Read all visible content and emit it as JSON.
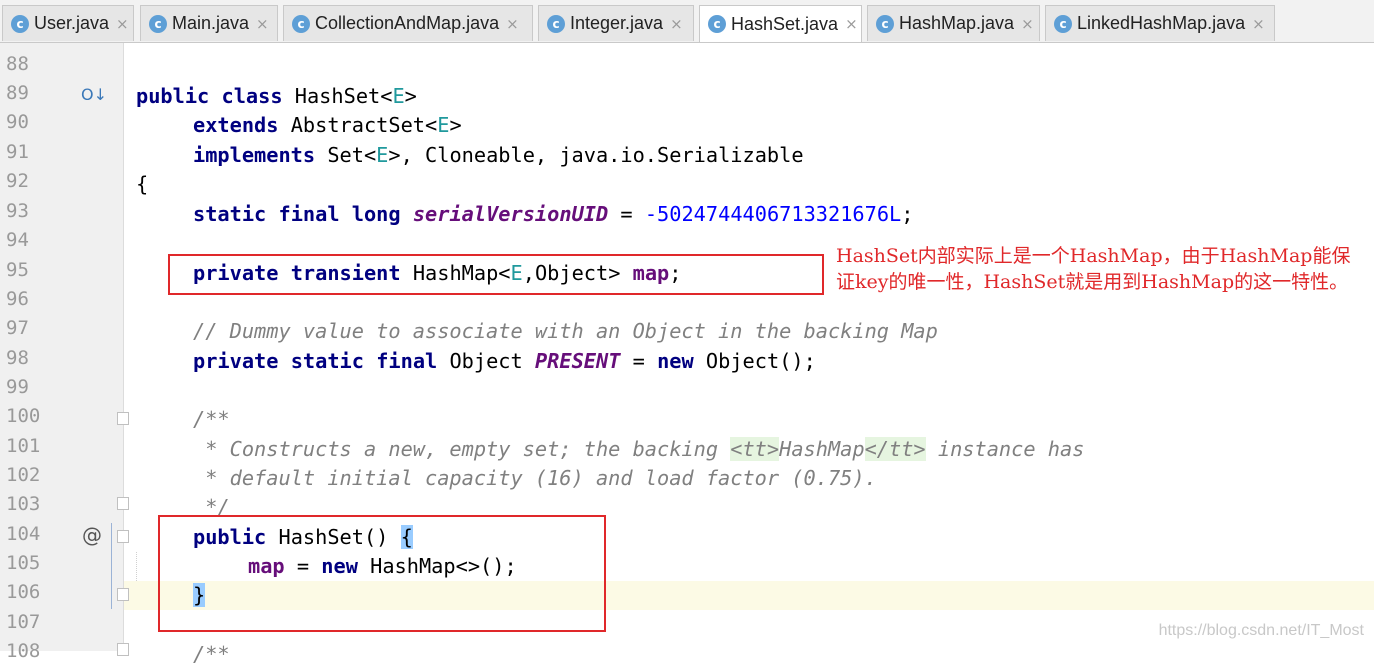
{
  "tabs": [
    {
      "label": "User.java",
      "active": false
    },
    {
      "label": "Main.java",
      "active": false
    },
    {
      "label": "CollectionAndMap.java",
      "active": false
    },
    {
      "label": "Integer.java",
      "active": false
    },
    {
      "label": "HashSet.java",
      "active": true
    },
    {
      "label": "HashMap.java",
      "active": false
    },
    {
      "label": "LinkedHashMap.java",
      "active": false
    }
  ],
  "tab_close_glyph": "×",
  "line_numbers": [
    "88",
    "89",
    "90",
    "91",
    "92",
    "93",
    "94",
    "95",
    "96",
    "97",
    "98",
    "99",
    "100",
    "101",
    "102",
    "103",
    "104",
    "105",
    "106",
    "107",
    "108"
  ],
  "code": {
    "l89": {
      "k1": "public",
      "k2": "class",
      "name": "HashSet<",
      "tp": "E",
      "end": ">"
    },
    "l90": {
      "k": "extends",
      "name": "AbstractSet<",
      "tp": "E",
      "end": ">"
    },
    "l91": {
      "k": "implements",
      "a": "Set<",
      "tp": "E",
      "rest": ">, Cloneable, java.io.Serializable"
    },
    "l92": {
      "text": "{"
    },
    "l93": {
      "k1": "static",
      "k2": "final",
      "k3": "long",
      "field": "serialVersionUID",
      "eq": "= ",
      "num": "-5024744406713321676L",
      "end": ";"
    },
    "l95": {
      "k1": "private",
      "k2": "transient",
      "a": "HashMap<",
      "tp": "E",
      "b": ",Object> ",
      "field": "map",
      "end": ";"
    },
    "l97": {
      "comment": "// Dummy value to associate with an Object in the backing Map"
    },
    "l98": {
      "k1": "private",
      "k2": "static",
      "k3": "final",
      "a": "Object ",
      "field": "PRESENT",
      "b": " = ",
      "k4": "new",
      "c": " Object();"
    },
    "l100": {
      "comment": "/**"
    },
    "l101": {
      "a": " * Constructs a new, empty set; the backing ",
      "t1": "<tt>",
      "b": "HashMap",
      "t2": "</tt>",
      "c": " instance has"
    },
    "l102": {
      "comment": " * default initial capacity (16) and load factor (0.75)."
    },
    "l103": {
      "comment": " */"
    },
    "l104": {
      "k": "public",
      "a": "HashSet() ",
      "brace": "{"
    },
    "l105": {
      "field": "map",
      "a": " = ",
      "k": "new",
      "b": " HashMap<>();"
    },
    "l106": {
      "brace": "}"
    },
    "l108": {
      "comment": "/**"
    }
  },
  "gutter_icons": {
    "override": "O↓",
    "annotation": "@"
  },
  "annotation_note": "HashSet内部实际上是一个HashMap，由于HashMap能保证key的唯一性，HashSet就是用到HashMap的这一特性。",
  "watermark": "https://blog.csdn.net/IT_Most",
  "colors": {
    "keyword": "#000080",
    "type_param": "#20999d",
    "field": "#660e7a",
    "number": "#0000ff",
    "comment": "#808080",
    "annotation_red": "#e0282a",
    "caret_line": "#fcfae5",
    "tab_icon": "#5e9fd6"
  }
}
